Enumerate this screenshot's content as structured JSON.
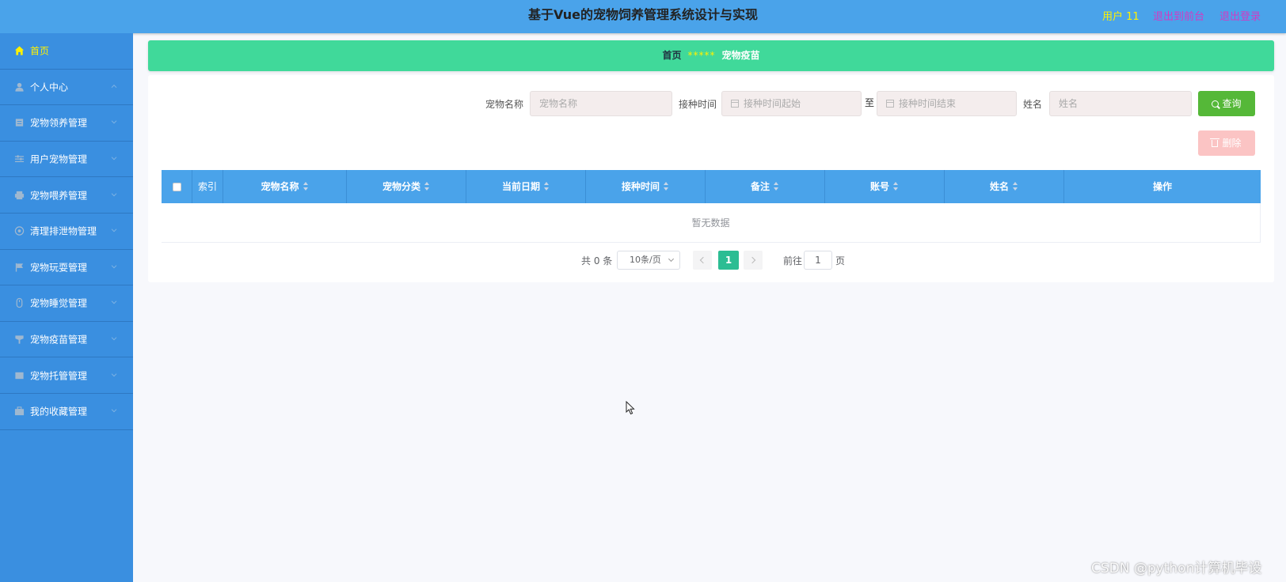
{
  "header": {
    "title": "基于Vue的宠物饲养管理系统设计与实现",
    "user": "用户 11",
    "back_to_front": "退出到前台",
    "logout": "退出登录"
  },
  "sidebar": {
    "items": [
      {
        "label": "首页",
        "icon": "home-icon",
        "active": true
      },
      {
        "label": "个人中心",
        "icon": "user-icon"
      },
      {
        "label": "宠物领养管理",
        "icon": "document-icon"
      },
      {
        "label": "用户宠物管理",
        "icon": "sliders-icon"
      },
      {
        "label": "宠物喂养管理",
        "icon": "printer-icon"
      },
      {
        "label": "清理排泄物管理",
        "icon": "aperture-icon"
      },
      {
        "label": "宠物玩耍管理",
        "icon": "flag-icon"
      },
      {
        "label": "宠物睡觉管理",
        "icon": "mouse-icon"
      },
      {
        "label": "宠物疫苗管理",
        "icon": "cup-icon"
      },
      {
        "label": "宠物托管管理",
        "icon": "tablet-icon"
      },
      {
        "label": "我的收藏管理",
        "icon": "briefcase-icon"
      }
    ]
  },
  "breadcrumb": {
    "home": "首页",
    "separator": "*****",
    "current": "宠物疫苗"
  },
  "search": {
    "pet_name_label": "宠物名称",
    "pet_name_placeholder": "宠物名称",
    "vaccine_time_label": "接种时间",
    "start_placeholder": "接种时间起始",
    "range_separator": "至",
    "end_placeholder": "接种时间结束",
    "name_label": "姓名",
    "name_placeholder": "姓名",
    "search_button": "查询",
    "delete_button": "删除"
  },
  "table": {
    "columns": [
      "索引",
      "宠物名称",
      "宠物分类",
      "当前日期",
      "接种时间",
      "备注",
      "账号",
      "姓名",
      "操作"
    ],
    "empty_text": "暂无数据"
  },
  "pagination": {
    "total_text": "共 0 条",
    "page_size": "10条/页",
    "current_page": "1",
    "goto_label": "前往",
    "goto_value": "1",
    "page_suffix": "页"
  },
  "watermark": "CSDN @python计算机毕设",
  "colors": {
    "header_bg": "#4aa3ea",
    "sidebar_bg": "#3a8fe0",
    "breadcrumb_bg": "#40d99a",
    "search_button": "#55b838",
    "delete_button": "#fbc4c4",
    "active_page": "#2cbd93",
    "highlight_yellow": "#fff100",
    "link_magenta": "#d23ac4"
  }
}
